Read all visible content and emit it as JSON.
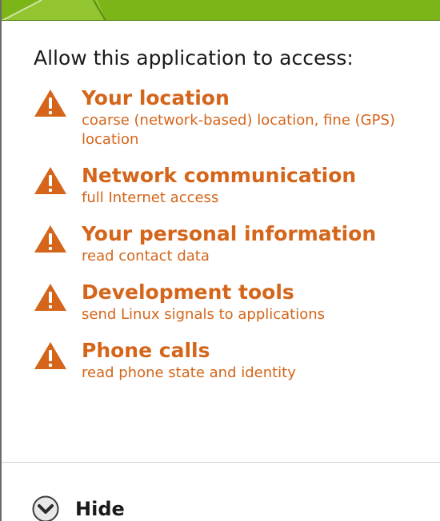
{
  "dialog": {
    "heading": "Allow this application to access:",
    "accent_color": "#d4651a",
    "header_color": "#7cb518",
    "permissions": [
      {
        "icon": "warning-icon",
        "title": "Your location",
        "desc": "coarse (network-based) location, fine (GPS) location"
      },
      {
        "icon": "warning-icon",
        "title": "Network communication",
        "desc": "full Internet access"
      },
      {
        "icon": "warning-icon",
        "title": "Your personal information",
        "desc": "read contact data"
      },
      {
        "icon": "warning-icon",
        "title": "Development tools",
        "desc": "send Linux signals to applications"
      },
      {
        "icon": "warning-icon",
        "title": "Phone calls",
        "desc": "read phone state and identity"
      }
    ],
    "toggle": {
      "icon": "chevron-down-icon",
      "label": "Hide"
    }
  }
}
